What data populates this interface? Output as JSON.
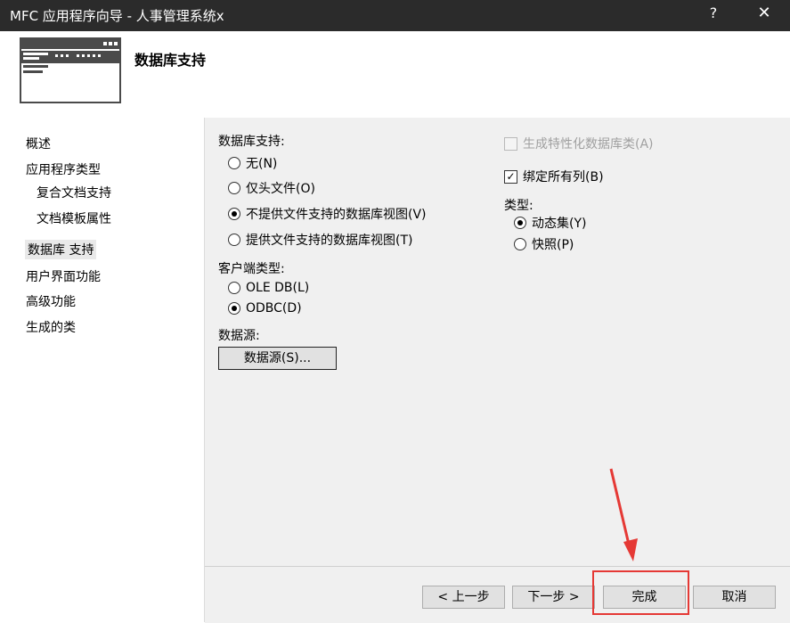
{
  "window": {
    "title": "MFC 应用程序向导 - 人事管理系统x",
    "help": "?",
    "close": "✕"
  },
  "header": {
    "title": "数据库支持"
  },
  "nav": {
    "items": [
      {
        "label": "概述"
      },
      {
        "label": "应用程序类型"
      },
      {
        "label": "复合文档支持"
      },
      {
        "label": "文档模板属性"
      },
      {
        "label": "数据库 支持"
      },
      {
        "label": "用户界面功能"
      },
      {
        "label": "高级功能"
      },
      {
        "label": "生成的类"
      }
    ]
  },
  "db_support": {
    "label": "数据库支持:",
    "options": [
      {
        "label": "无(N)"
      },
      {
        "label": "仅头文件(O)"
      },
      {
        "label": "不提供文件支持的数据库视图(V)"
      },
      {
        "label": "提供文件支持的数据库视图(T)"
      }
    ]
  },
  "client_type": {
    "label": "客户端类型:",
    "options": [
      {
        "label": "OLE DB(L)"
      },
      {
        "label": "ODBC(D)"
      }
    ]
  },
  "data_source": {
    "label": "数据源:",
    "button": "数据源(S)..."
  },
  "right_options": {
    "custom_db_class": "生成特性化数据库类(A)",
    "bind_all_columns": "绑定所有列(B)",
    "type_label": "类型:",
    "types": [
      {
        "label": "动态集(Y)"
      },
      {
        "label": "快照(P)"
      }
    ]
  },
  "footer": {
    "prev": "< 上一步",
    "next": "下一步 >",
    "finish": "完成",
    "cancel": "取消"
  },
  "colors": {
    "titlebar": "#2b2b2b",
    "content_bg": "#f0f0f0",
    "annotation": "#e53935"
  }
}
